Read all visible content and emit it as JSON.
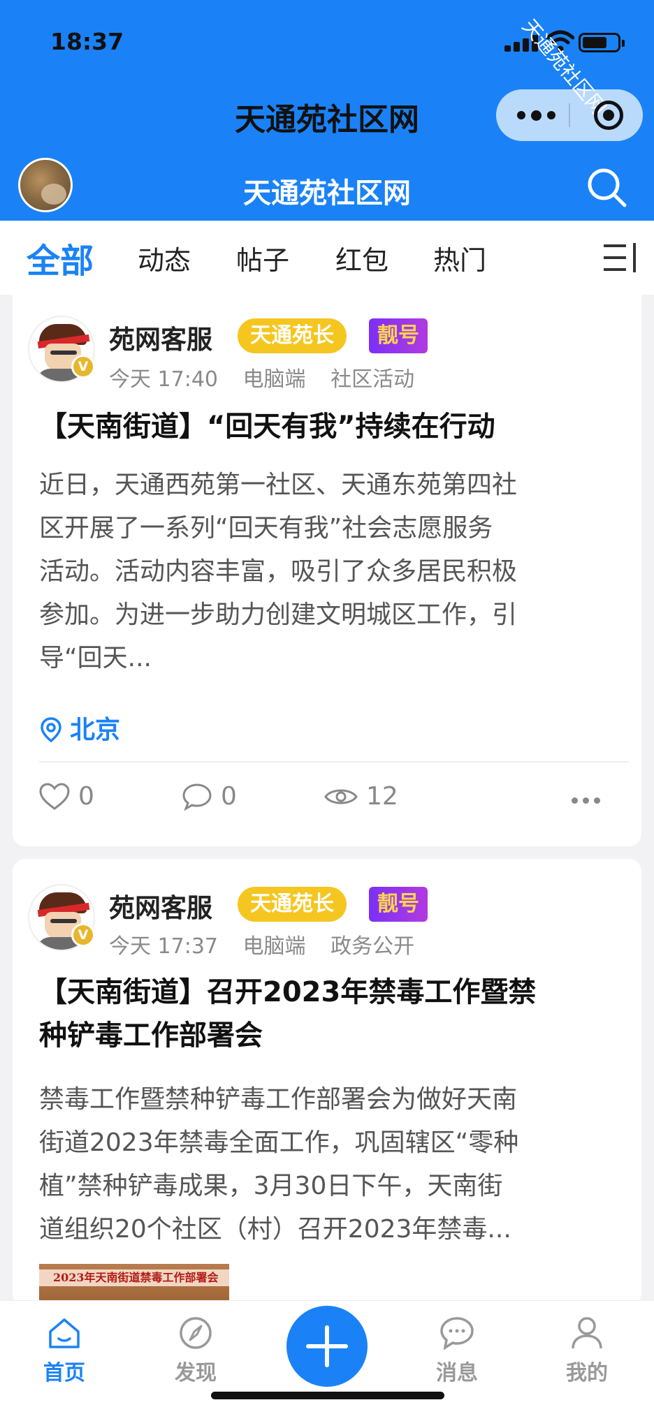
{
  "status_bar": {
    "time": "18:37"
  },
  "watermark": "天通苑社区网",
  "mini_program": {
    "title": "天通苑社区网"
  },
  "header": {
    "title": "天通苑社区网"
  },
  "tabs": [
    {
      "label": "全部",
      "active": true
    },
    {
      "label": "动态"
    },
    {
      "label": "帖子"
    },
    {
      "label": "红包"
    },
    {
      "label": "热门"
    }
  ],
  "posts": [
    {
      "author": "苑网客服",
      "badge_role": "天通苑长",
      "badge_vip": "靓号",
      "verified": "V",
      "time": "今天 17:40",
      "source": "电脑端",
      "category": "社区活动",
      "title": "【天南街道】“回天有我”持续在行动",
      "body_lines": [
        "近日，天通西苑第一社区、天通东苑第四社",
        "区开展了一系列“回天有我”社会志愿服务",
        "活动。活动内容丰富，吸引了众多居民积极",
        "参加。为进一步助力创建文明城区工作，引",
        "导“回天..."
      ],
      "location": "北京",
      "likes": "0",
      "comments": "0",
      "views": "12"
    },
    {
      "author": "苑网客服",
      "badge_role": "天通苑长",
      "badge_vip": "靓号",
      "verified": "V",
      "time": "今天 17:37",
      "source": "电脑端",
      "category": "政务公开",
      "title_lines": [
        "【天南街道】召开2023年禁毒工作暨禁",
        "种铲毒工作部署会"
      ],
      "body_lines": [
        "禁毒工作暨禁种铲毒工作部署会为做好天南",
        "街道2023年禁毒全面工作，巩固辖区“零种",
        "植”禁种铲毒成果，3月30日下午，天南街",
        "道组织20个社区（村）召开2023年禁毒..."
      ],
      "image_banner": "2023年天南街道禁毒工作部署会"
    }
  ],
  "tabbar": [
    {
      "label": "首页",
      "icon": "home-icon",
      "active": true
    },
    {
      "label": "发现",
      "icon": "compass-icon"
    },
    {
      "label": "消息",
      "icon": "message-icon"
    },
    {
      "label": "我的",
      "icon": "user-icon"
    }
  ],
  "colors": {
    "brand": "#1a82f6",
    "gold": "#f5c61f",
    "purple": "#7b2ff7"
  }
}
